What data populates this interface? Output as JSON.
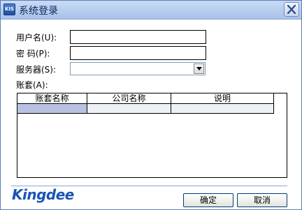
{
  "titlebar": {
    "app_icon_text": "KIS",
    "title": "系统登录",
    "close_icon": "close-icon"
  },
  "form": {
    "username_label": "用户名(U):",
    "username_value": "",
    "password_label": "密  码(P):",
    "password_value": "",
    "server_label": "服务器(S):",
    "server_value": "",
    "account_label": "账套(A):"
  },
  "grid": {
    "columns": [
      "账套名称",
      "公司名称",
      "说明"
    ],
    "rows": [
      [
        "",
        "",
        ""
      ]
    ]
  },
  "footer": {
    "logo": "Kingdee",
    "ok_label": "确定",
    "cancel_label": "取消"
  }
}
